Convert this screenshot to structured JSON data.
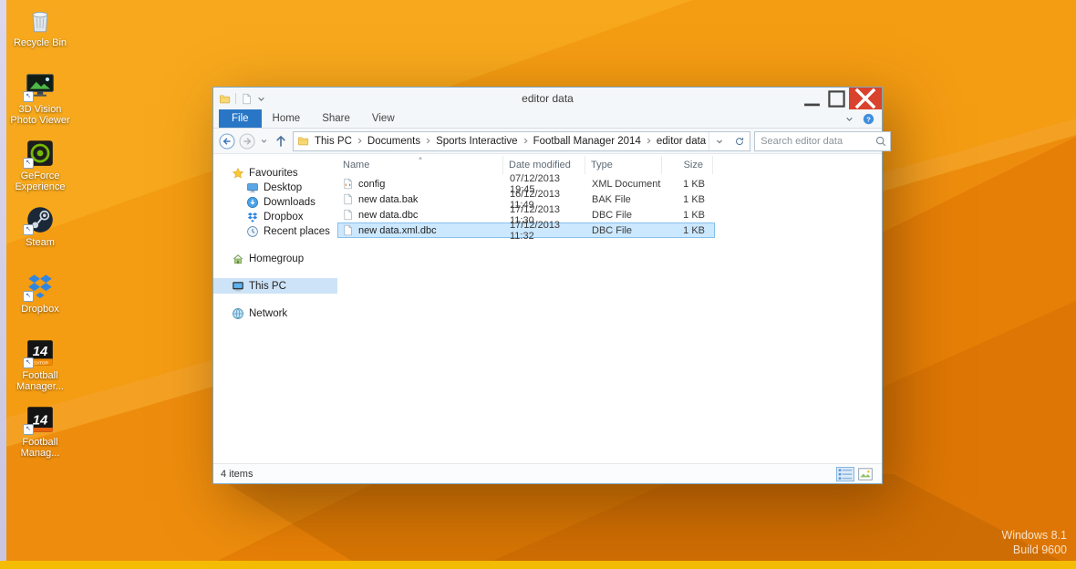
{
  "colors": {
    "accent_blue": "#2a76c6",
    "close_red": "#d9422c",
    "selection_fill": "#cce8ff",
    "selection_border": "#84c0ec",
    "wallpaper_orange": "#ef8f13"
  },
  "desktop": {
    "icons": [
      {
        "id": "recycle-bin",
        "label": "Recycle Bin",
        "shortcut": false
      },
      {
        "id": "photo-viewer",
        "label": "3D Vision Photo Viewer",
        "shortcut": true
      },
      {
        "id": "geforce",
        "label": "GeForce Experience",
        "shortcut": true
      },
      {
        "id": "steam",
        "label": "Steam",
        "shortcut": true
      },
      {
        "id": "dropbox",
        "label": "Dropbox",
        "shortcut": true
      },
      {
        "id": "fm-editor",
        "label": "Football Manager...",
        "shortcut": true
      },
      {
        "id": "fm",
        "label": "Football Manag...",
        "shortcut": true
      }
    ],
    "watermark_line1": "Windows 8.1",
    "watermark_line2": "Build 9600"
  },
  "window": {
    "title": "editor data",
    "tabs": [
      {
        "label": "File",
        "accent": true
      },
      {
        "label": "Home",
        "accent": false
      },
      {
        "label": "Share",
        "accent": false
      },
      {
        "label": "View",
        "accent": false
      }
    ],
    "breadcrumb": [
      "This PC",
      "Documents",
      "Sports Interactive",
      "Football Manager 2014",
      "editor data"
    ],
    "search_placeholder": "Search editor data",
    "nav": [
      {
        "id": "favourites",
        "label": "Favourites",
        "icon": "star",
        "selected": false,
        "children": [
          {
            "id": "desktop",
            "label": "Desktop",
            "icon": "monitor"
          },
          {
            "id": "downloads",
            "label": "Downloads",
            "icon": "downloads"
          },
          {
            "id": "dropbox",
            "label": "Dropbox",
            "icon": "dropbox"
          },
          {
            "id": "recent-places",
            "label": "Recent places",
            "icon": "clock"
          }
        ]
      },
      {
        "id": "homegroup",
        "label": "Homegroup",
        "icon": "homegroup",
        "selected": false,
        "children": []
      },
      {
        "id": "this-pc",
        "label": "This PC",
        "icon": "computer",
        "selected": true,
        "children": []
      },
      {
        "id": "network",
        "label": "Network",
        "icon": "network",
        "selected": false,
        "children": []
      }
    ],
    "columns": [
      "Name",
      "Date modified",
      "Type",
      "Size"
    ],
    "files": [
      {
        "name": "config",
        "modified": "07/12/2013 19:45",
        "type": "XML Document",
        "size": "1 KB",
        "icon": "xml-doc",
        "selected": false
      },
      {
        "name": "new data.bak",
        "modified": "16/12/2013 11:49",
        "type": "BAK File",
        "size": "1 KB",
        "icon": "page",
        "selected": false
      },
      {
        "name": "new data.dbc",
        "modified": "17/12/2013 11:30",
        "type": "DBC File",
        "size": "1 KB",
        "icon": "page",
        "selected": false
      },
      {
        "name": "new data.xml.dbc",
        "modified": "17/12/2013 11:32",
        "type": "DBC File",
        "size": "1 KB",
        "icon": "page",
        "selected": true
      }
    ],
    "status": "4 items"
  }
}
